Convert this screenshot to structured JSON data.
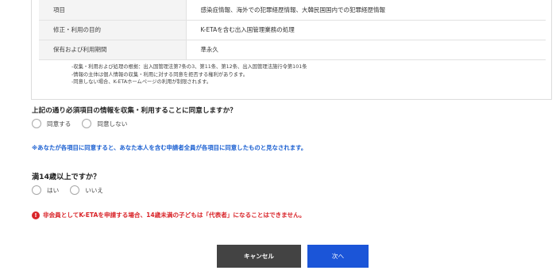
{
  "table": {
    "rows": [
      {
        "label": "項目",
        "value": "感染症情報、海外での犯罪経歴情報、大韓民国国内での犯罪経歴情報"
      },
      {
        "label": "修正・利用の目的",
        "value": "K-ETAを含む出入国管理業務の処理"
      },
      {
        "label": "保有および利用期間",
        "value": "準永久"
      }
    ]
  },
  "notes": [
    "-収集・利用および処理の根拠：出入国管理法第7条の3、第11条、第12条、出入国管理法施行令第101条",
    "-情報の主体は個人情報の収集・利用に対する同意を拒否する権利があります。",
    "-同意しない場合、K-ETAホームページの利用が制限されます。"
  ],
  "consent_question": "上記の通り必須項目の情報を収集・利用することに同意しますか？",
  "consent_options": {
    "agree": "同意する",
    "disagree": "同意しない"
  },
  "consent_info": "※あなたが各項目に同意すると、あなた本人を含む申請者全員が各項目に同意したものと見なされます。",
  "age_question": "満14歳以上ですか？",
  "age_options": {
    "yes": "はい",
    "no": "いいえ"
  },
  "warning": {
    "icon": "!",
    "text": "非会員としてK-ETAを申請する場合、14歳未満の子どもは「代表者」になることはできません。"
  },
  "buttons": {
    "cancel": "キャンセル",
    "next": "次へ"
  },
  "colors": {
    "accent_blue": "#1b55d8",
    "info_blue": "#1a5fd1",
    "warning_red": "#d9252a",
    "cancel_gray": "#434343"
  }
}
